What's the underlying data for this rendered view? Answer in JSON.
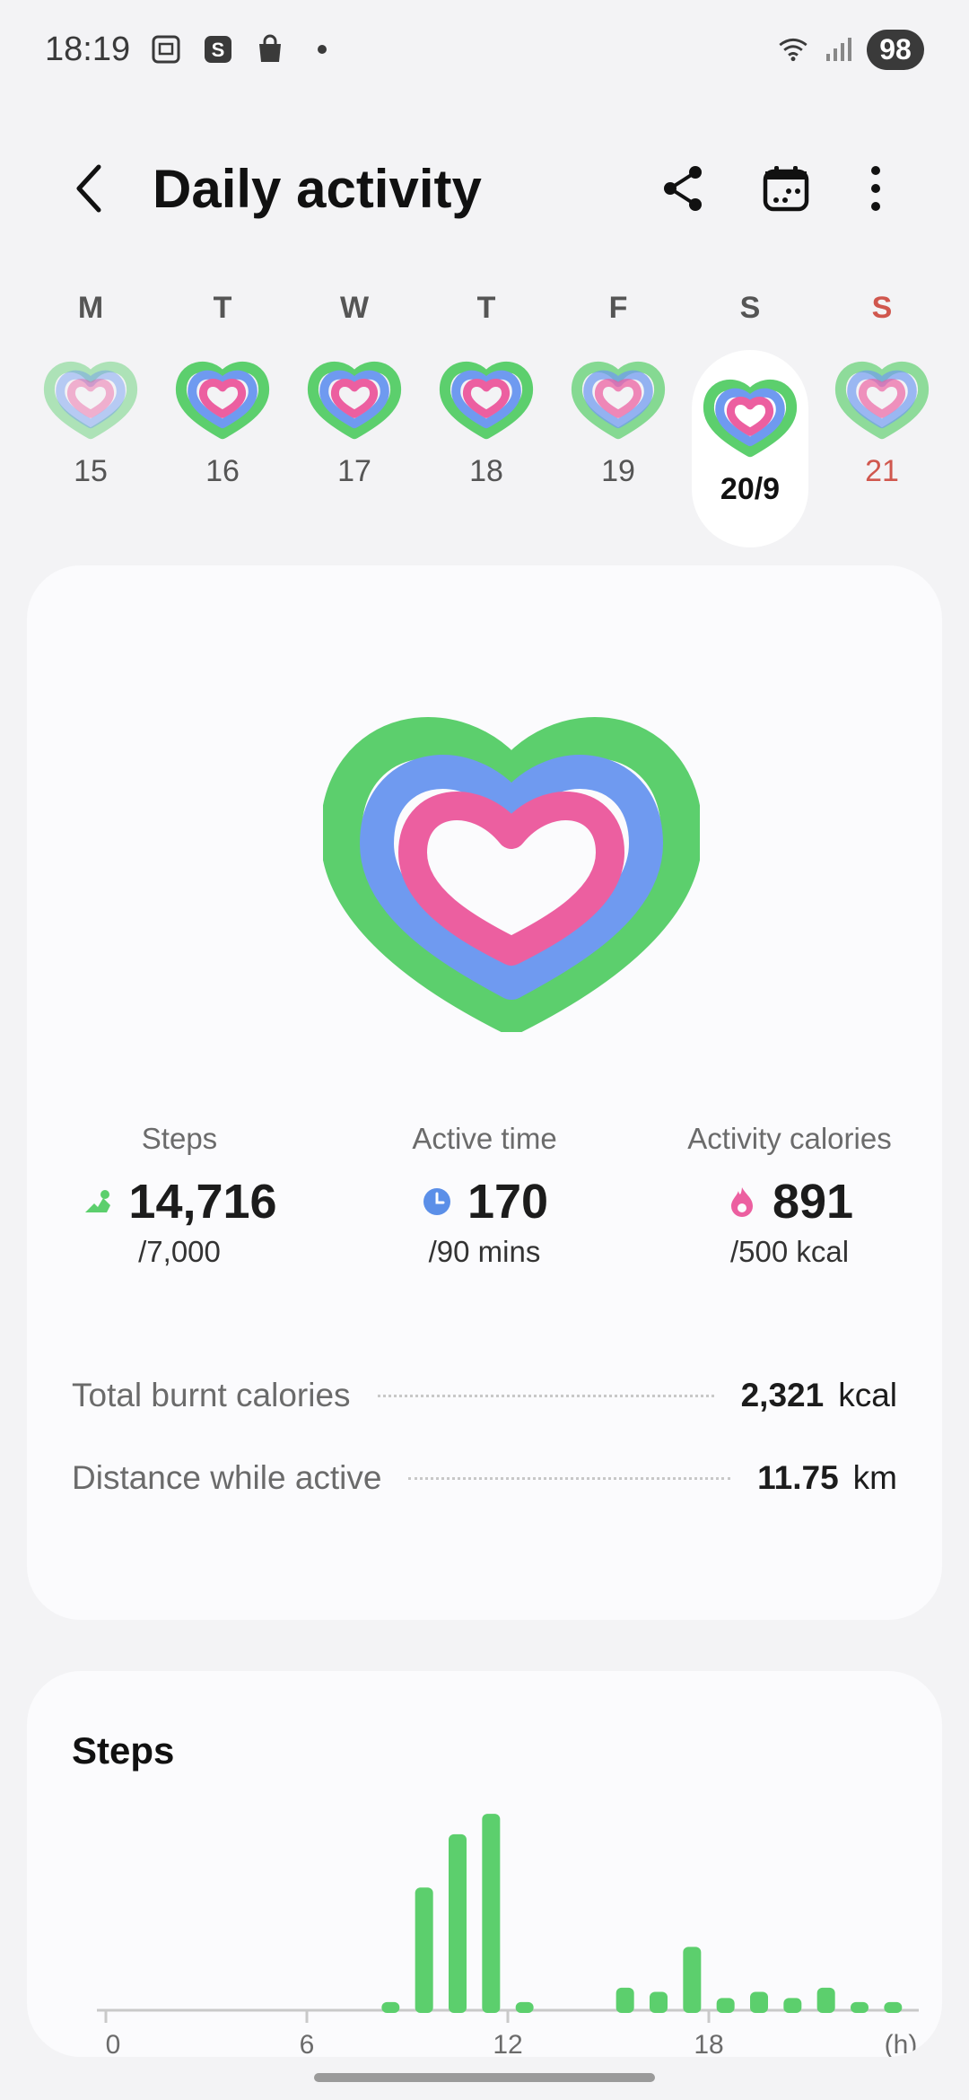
{
  "status_bar": {
    "time": "18:19",
    "icons": [
      "screenshot-icon",
      "samsung-pay-icon",
      "shopping-bag-icon",
      "dot-icon"
    ],
    "right_icons": [
      "wifi-icon",
      "signal-icon"
    ],
    "battery": "98"
  },
  "header": {
    "title": "Daily activity",
    "back_icon": "chevron-left-icon",
    "share_icon": "share-icon",
    "calendar_icon": "calendar-icon",
    "more_icon": "more-vertical-icon"
  },
  "week": {
    "days": [
      {
        "letter": "M",
        "num": "15",
        "progress": 0.35
      },
      {
        "letter": "T",
        "num": "16",
        "progress": 1.0
      },
      {
        "letter": "W",
        "num": "17",
        "progress": 1.0
      },
      {
        "letter": "T",
        "num": "18",
        "progress": 1.0
      },
      {
        "letter": "F",
        "num": "19",
        "progress": 0.8
      },
      {
        "letter": "S",
        "num": "20/9",
        "progress": 1.0,
        "selected": true
      },
      {
        "letter": "S",
        "num": "21",
        "progress": 0.7,
        "sunday": true
      }
    ]
  },
  "summary": {
    "metrics": [
      {
        "label": "Steps",
        "value": "14,716",
        "goal": "/7,000",
        "icon": "shoe-icon",
        "color": "#5ccf6d"
      },
      {
        "label": "Active time",
        "value": "170",
        "goal": "/90 mins",
        "icon": "clock-icon",
        "color": "#5b8fe8"
      },
      {
        "label": "Activity calories",
        "value": "891",
        "goal": "/500 kcal",
        "icon": "flame-icon",
        "color": "#ec5fa0"
      }
    ],
    "total_burnt": {
      "label": "Total burnt calories",
      "value": "2,321",
      "unit": "kcal"
    },
    "distance": {
      "label": "Distance while active",
      "value": "11.75",
      "unit": "km"
    }
  },
  "steps_card": {
    "title": "Steps",
    "chart_data": {
      "type": "bar",
      "x_ticks": [
        "0",
        "6",
        "12",
        "18",
        "(h)"
      ],
      "x_unit": "(h)",
      "x": [
        8,
        9,
        10,
        11,
        12,
        15,
        16,
        17,
        18,
        19,
        20,
        21,
        22,
        23
      ],
      "values": [
        4,
        60,
        86,
        96,
        4,
        11,
        9,
        31,
        6,
        9,
        6,
        11,
        4,
        4
      ],
      "ylim": [
        0,
        100
      ],
      "color": "#5ccf6d"
    }
  },
  "colors": {
    "green": "#5ccf6d",
    "blue": "#6f9af0",
    "pink": "#ec5fa0",
    "sunday": "#d0574e"
  }
}
